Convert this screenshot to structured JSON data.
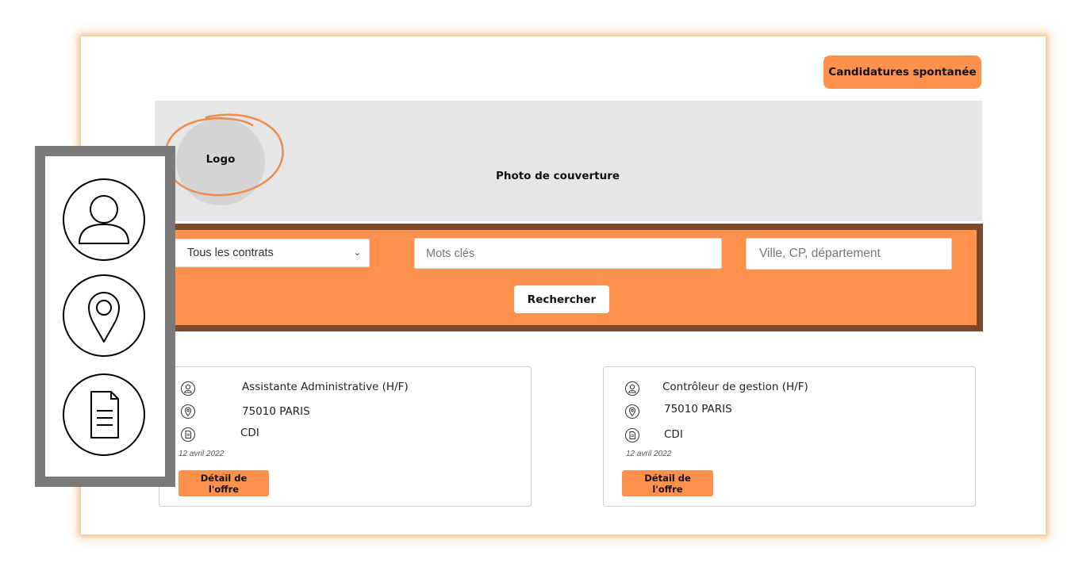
{
  "header": {
    "spontaneous_label": "Candidatures spontanée"
  },
  "cover": {
    "logo_label": "Logo",
    "cover_label": "Photo de couverture"
  },
  "search": {
    "contract_select": "Tous les contrats",
    "keywords_placeholder": "Mots clés",
    "location_placeholder": "Ville, CP, département",
    "search_button": "Rechercher"
  },
  "offers": [
    {
      "title": "Assistante Administrative (H/F)",
      "location": "75010 PARIS",
      "contract": "CDI",
      "date": "12 avril 2022",
      "detail_label": "Détail de l'offre"
    },
    {
      "title": "Contrôleur de gestion (H/F)",
      "location": "75010 PARIS",
      "contract": "CDI",
      "date": "12 avril 2022",
      "detail_label": "Détail de l'offre"
    }
  ],
  "side_panel": {
    "icons": [
      "user-icon",
      "location-pin-icon",
      "document-icon"
    ]
  },
  "colors": {
    "accent": "#ff914d",
    "band_border": "#7a4a2b",
    "cover_bg": "#e6e6e6",
    "panel_border": "#7a7a7a"
  }
}
